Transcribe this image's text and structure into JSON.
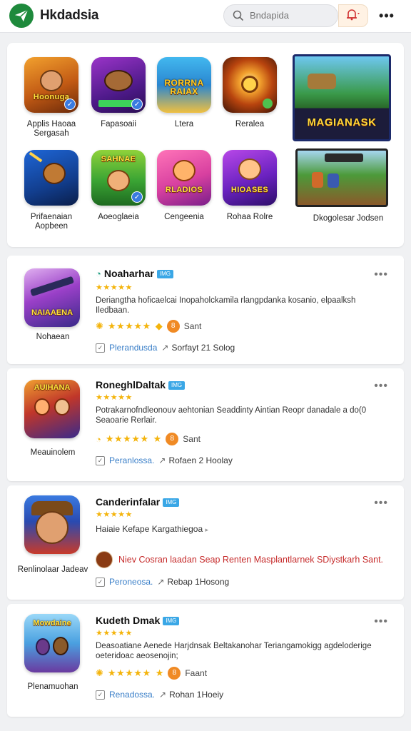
{
  "header": {
    "brand": "Hkdadsia",
    "search_placeholder": "Bndapida",
    "more_label": "•••",
    "logo_icon": "paper-plane-icon",
    "search_icon": "search-icon",
    "bell_icon": "bell-icon"
  },
  "featured": {
    "items": [
      {
        "art": "Hoonuga",
        "label": "Applis Haoaa Sergasah"
      },
      {
        "art": "",
        "label": "Fapasoaii"
      },
      {
        "art": "RORRNA RAIAX",
        "label": "Ltera"
      },
      {
        "art": "",
        "label": "Reralea"
      },
      {
        "art": "",
        "label": "Prifaenaian Aopbeen"
      },
      {
        "art": "SAHNAE",
        "label": "Aoeoglaeia"
      },
      {
        "art": "RLADIOS",
        "label": "Cengeenia"
      },
      {
        "art": "HIOASES",
        "label": "Rohaa Rolre"
      }
    ],
    "banner_title": "MAGIANASK",
    "banner_label": "Dkogolesar Jodsen"
  },
  "list": [
    {
      "name": "Noaharhar",
      "tag": "IMG",
      "icon_name": "Nohaean",
      "icon_art": "NAIAAENA",
      "stars": "★★★★★",
      "description": "Deriangtha hoficaelcai Inopaholckamila rlangpdanka kosanio, elpaalksh Iledbaan.",
      "rating_text": "Sant",
      "rating_num": "8",
      "category": "Plerandusda",
      "category_extra": "Sorfayt 21 Solog"
    },
    {
      "name": "RoneghlDaltak",
      "tag": "IMG",
      "icon_name": "Meauinolem",
      "icon_art": "AUIHANA",
      "stars": "★★★★★",
      "description": "Potrakarnofndleonouv aehtonian Seaddinty Aintian Reopr danadale a do(0 Seaoarie Rerlair.",
      "rating_text": "Sant",
      "rating_num": "8",
      "category": "Peranlossa.",
      "category_extra": "Rofaen 2 Hoolay"
    },
    {
      "name": "Canderinfalar",
      "tag": "IMG",
      "icon_name": "Renlinolaar Jadeav",
      "icon_art": "",
      "stars": "★★★★★",
      "description": "Haiaie  Kefape Kargathiegoa",
      "banner_text": "Niev Cosran laadan Seap Renten Masplantlarnek SDiystkarh Sant.",
      "category": "Peroneosa.",
      "category_extra": "Rebap 1Hosong"
    },
    {
      "name": "Kudeth Dmak",
      "tag": "IMG",
      "icon_name": "Plenamuohan",
      "icon_art": "Mowdaine",
      "stars": "★★★★★",
      "description": "Deasoatiane Aenede Harjdnsak Beltakanohar Teriangamokigg agdeloderige oeteridoac aeosenojin;",
      "rating_text": "Faant",
      "rating_num": "8",
      "category": "Renadossa.",
      "category_extra": "Rohan 1Hoeiy"
    }
  ],
  "colors": {
    "brand_green": "#1e8a3c",
    "star": "#f4b40c",
    "link": "#3a7fc8",
    "alert_red": "#c62b2b"
  }
}
